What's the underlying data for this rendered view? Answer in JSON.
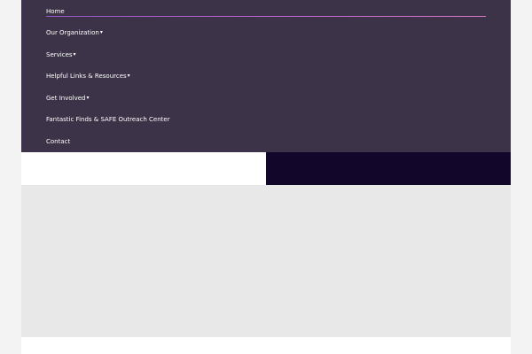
{
  "nav": {
    "items": [
      {
        "label": "Home",
        "has_dropdown": false,
        "active": true
      },
      {
        "label": "Our Organization",
        "has_dropdown": true,
        "active": false
      },
      {
        "label": "Services",
        "has_dropdown": true,
        "active": false
      },
      {
        "label": "Helpful Links & Resources",
        "has_dropdown": true,
        "active": false
      },
      {
        "label": "Get Involved",
        "has_dropdown": true,
        "active": false
      },
      {
        "label": "Fantastic Finds & SAFE Outreach Center",
        "has_dropdown": false,
        "active": false
      },
      {
        "label": "Contact",
        "has_dropdown": false,
        "active": false
      }
    ],
    "dropdown_icon": "chevron-down-icon"
  },
  "colors": {
    "nav_background": "#3d3349",
    "active_underline": "#c46bd4",
    "dark_strip": "#12062a",
    "content_background": "#e8e8e8"
  }
}
